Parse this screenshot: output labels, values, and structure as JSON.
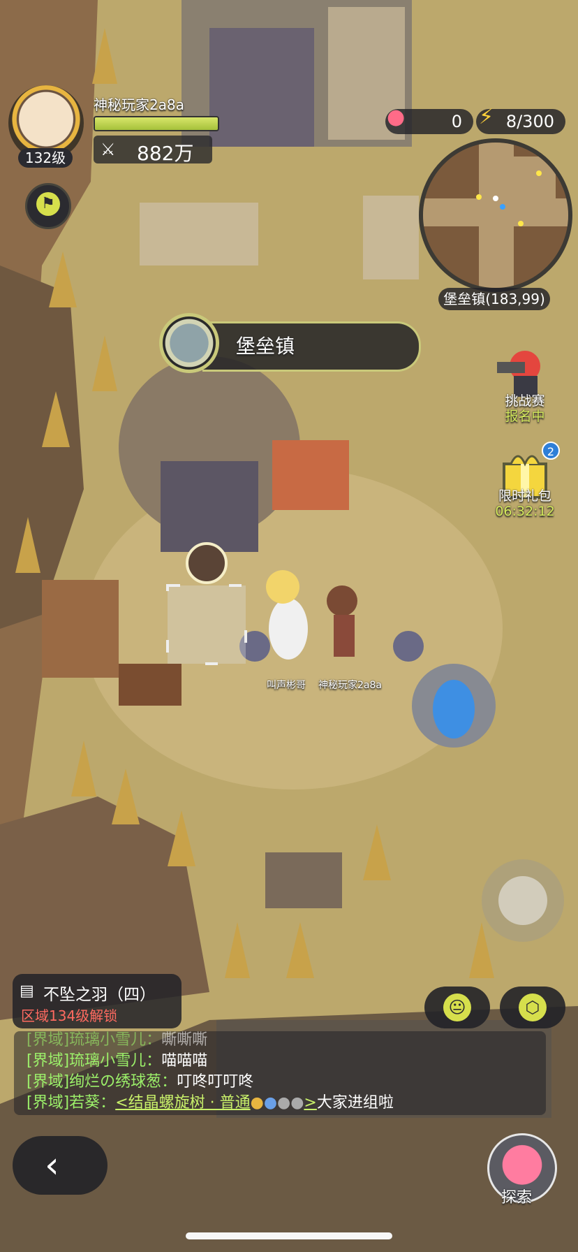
{
  "player": {
    "name": "神秘玩家2a8a",
    "level": "132级",
    "power_icon": "crossed-swords-icon",
    "power": "882万"
  },
  "resources": {
    "apples": "0",
    "energy": "8/300"
  },
  "minimap": {
    "location": "堡垒镇(183,99)"
  },
  "location_banner": {
    "title": "堡垒镇"
  },
  "events": {
    "challenge_title": "挑战赛",
    "challenge_status": "报名中",
    "gift_title": "限时礼包",
    "gift_timer": "06:32:12",
    "gift_badge": "2"
  },
  "characters": {
    "npc_name": "叫声彬哥",
    "player_name": "神秘玩家2a8a"
  },
  "quest": {
    "title": "不坠之羽（四）",
    "subtitle": "区域134级解锁"
  },
  "chat": [
    {
      "tag": "[界域]",
      "speaker": "琉璃小雪儿：",
      "text": "嘶嘶嘶"
    },
    {
      "tag": "[界域]",
      "speaker": "琉璃小雪儿：",
      "text": "喵喵喵"
    },
    {
      "tag": "[界域]",
      "speaker": "绚烂の绣球葱：",
      "text": "叮咚叮叮咚"
    },
    {
      "tag": "[界域]",
      "speaker": "若葵：",
      "link": "<结晶螺旋树 · 普通",
      "link_end": ">",
      "text": "大家进组啦"
    }
  ],
  "bottom": {
    "explore_label": "探索"
  }
}
